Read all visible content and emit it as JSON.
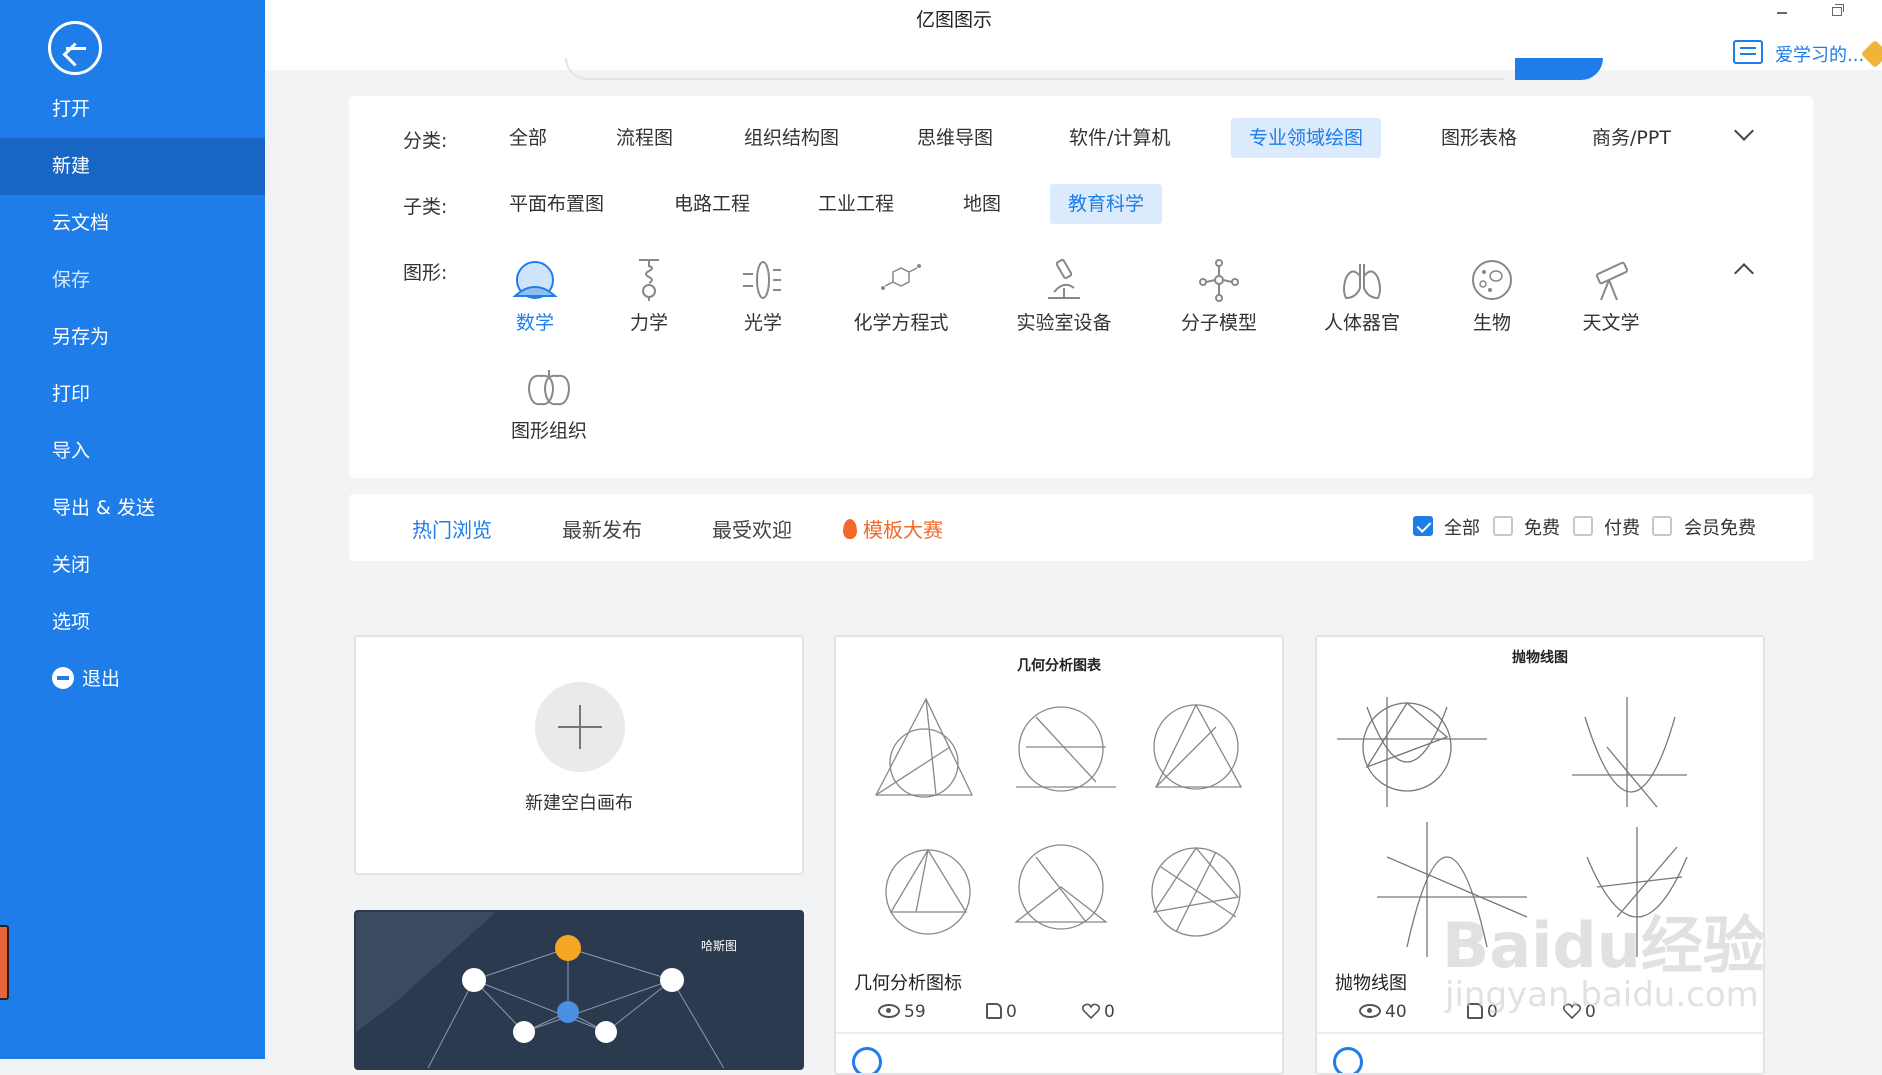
{
  "app": {
    "title": "亿图图示",
    "user_name": "爱学习的..."
  },
  "sidebar": {
    "items": [
      {
        "label": "打开"
      },
      {
        "label": "新建"
      },
      {
        "label": "云文档"
      },
      {
        "label": "保存"
      },
      {
        "label": "另存为"
      },
      {
        "label": "打印"
      },
      {
        "label": "导入"
      },
      {
        "label": "导出 & 发送"
      },
      {
        "label": "关闭"
      },
      {
        "label": "选项"
      },
      {
        "label": "退出"
      }
    ],
    "active": "新建"
  },
  "filters": {
    "category_label": "分类:",
    "categories": [
      "全部",
      "流程图",
      "组织结构图",
      "思维导图",
      "软件/计算机",
      "专业领域绘图",
      "图形表格",
      "商务/PPT"
    ],
    "category_selected": "专业领域绘图",
    "subcategory_label": "子类:",
    "subcategories": [
      "平面布置图",
      "电路工程",
      "工业工程",
      "地图",
      "教育科学"
    ],
    "subcategory_selected": "教育科学",
    "shape_label": "图形:",
    "shapes": [
      "数学",
      "力学",
      "光学",
      "化学方程式",
      "实验室设备",
      "分子模型",
      "人体器官",
      "生物",
      "天文学",
      "图形组织"
    ],
    "shape_selected": "数学"
  },
  "tabs": {
    "items": [
      "热门浏览",
      "最新发布",
      "最受欢迎",
      "模板大赛"
    ],
    "active": "热门浏览"
  },
  "price_filters": [
    {
      "label": "全部",
      "checked": true
    },
    {
      "label": "免费",
      "checked": false
    },
    {
      "label": "付费",
      "checked": false
    },
    {
      "label": "会员免费",
      "checked": false
    }
  ],
  "cards": {
    "new_blank": "新建空白画布",
    "dark_title": "哈斯图",
    "templates": [
      {
        "thumb_title": "几何分析图表",
        "name": "几何分析图标",
        "views": "59",
        "likes": "0",
        "favs": "0"
      },
      {
        "thumb_title": "抛物线图",
        "name": "抛物线图",
        "views": "40",
        "likes": "0",
        "favs": "0"
      }
    ]
  },
  "watermark": {
    "brand": "Baidu经验",
    "url": "jingyan.baidu.com"
  },
  "colors": {
    "primary": "#1e7de8",
    "sidebar_active": "#1866c4",
    "hot": "#f06a2c"
  }
}
